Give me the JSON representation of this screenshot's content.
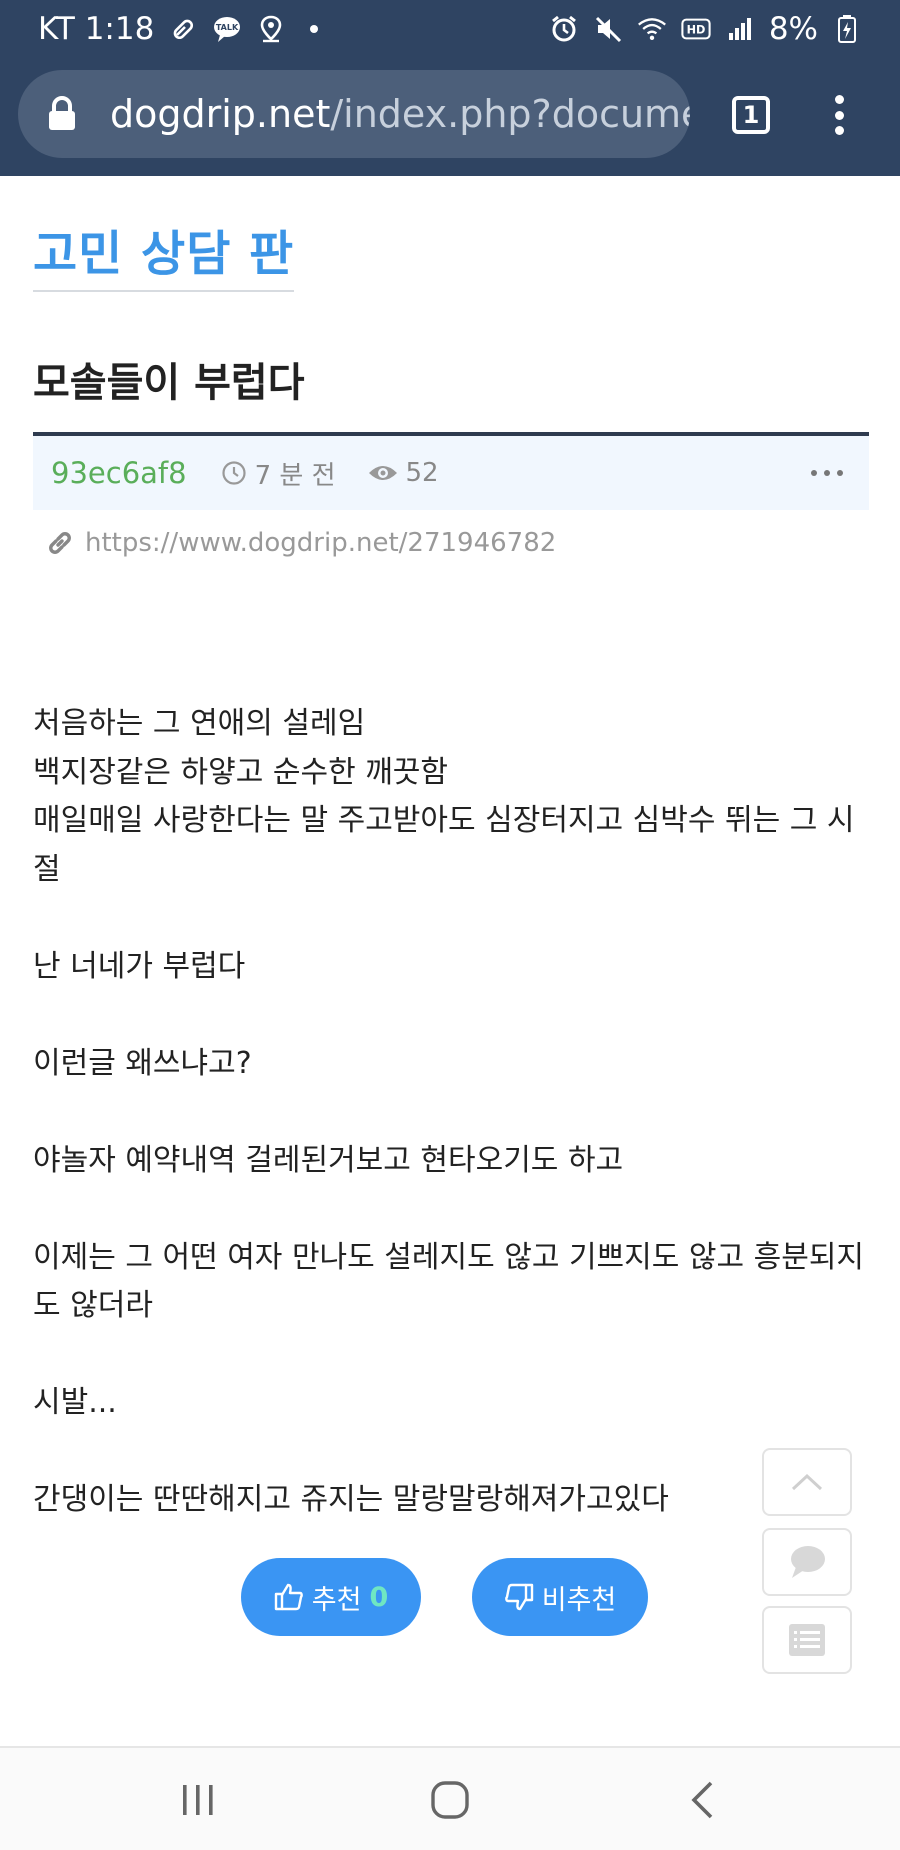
{
  "status_bar": {
    "carrier_time": "KT 1:18",
    "battery": "8%"
  },
  "browser": {
    "url_domain": "dogdrip.net",
    "url_path": "/index.php?document",
    "tab_count": "1"
  },
  "board": {
    "title": "고민 상담 판"
  },
  "post": {
    "title": "모솔들이 부럽다",
    "author": "93ec6af8",
    "time": "7 분 전",
    "views": "52",
    "permalink": "https://www.dogdrip.net/271946782",
    "body": [
      "처음하는 그 연애의 설레임",
      "백지장같은 하얗고 순수한 깨끗함",
      "매일매일 사랑한다는 말 주고받아도 심장터지고 심박수 뛰는 그 시절",
      "",
      "난 너네가 부럽다",
      "",
      "이런글 왜쓰냐고?",
      "",
      "야놀자 예약내역 걸레된거보고 현타오기도 하고",
      "",
      "이제는 그 어떤 여자 만나도 설레지도 않고 기쁘지도 않고 흥분되지도 않더라",
      "",
      "시발...",
      "",
      "간댕이는 딴딴해지고 쥬지는 말랑말랑해져가고있다"
    ]
  },
  "votes": {
    "upvote_label": "추천",
    "upvote_count": "0",
    "downvote_label": "비추천"
  },
  "colors": {
    "chrome": "#2f4462",
    "accent": "#3c95e6",
    "vote_button": "#3a95f3",
    "author": "#5aae5a"
  }
}
